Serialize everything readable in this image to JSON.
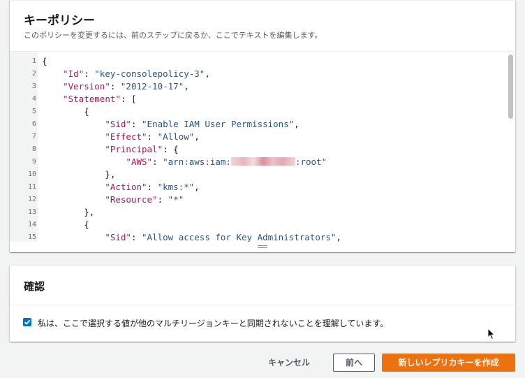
{
  "policy_panel": {
    "title": "キーポリシー",
    "description": "このポリシーを変更するには、前のステップに戻るか、ここでテキストを編集します。"
  },
  "editor": {
    "line_numbers": [
      "1",
      "2",
      "3",
      "4",
      "5",
      "6",
      "7",
      "8",
      "9",
      "10",
      "11",
      "12",
      "13",
      "14",
      "15"
    ],
    "lines": [
      [
        {
          "t": "p",
          "v": "{"
        }
      ],
      [
        {
          "t": "p",
          "v": "    "
        },
        {
          "t": "k",
          "v": "\"Id\""
        },
        {
          "t": "p",
          "v": ": "
        },
        {
          "t": "s",
          "v": "\"key-consolepolicy-3\""
        },
        {
          "t": "p",
          "v": ","
        }
      ],
      [
        {
          "t": "p",
          "v": "    "
        },
        {
          "t": "k",
          "v": "\"Version\""
        },
        {
          "t": "p",
          "v": ": "
        },
        {
          "t": "s",
          "v": "\"2012-10-17\""
        },
        {
          "t": "p",
          "v": ","
        }
      ],
      [
        {
          "t": "p",
          "v": "    "
        },
        {
          "t": "k",
          "v": "\"Statement\""
        },
        {
          "t": "p",
          "v": ": ["
        }
      ],
      [
        {
          "t": "p",
          "v": "        {"
        }
      ],
      [
        {
          "t": "p",
          "v": "            "
        },
        {
          "t": "k",
          "v": "\"Sid\""
        },
        {
          "t": "p",
          "v": ": "
        },
        {
          "t": "s",
          "v": "\"Enable IAM User Permissions\""
        },
        {
          "t": "p",
          "v": ","
        }
      ],
      [
        {
          "t": "p",
          "v": "            "
        },
        {
          "t": "k",
          "v": "\"Effect\""
        },
        {
          "t": "p",
          "v": ": "
        },
        {
          "t": "s",
          "v": "\"Allow\""
        },
        {
          "t": "p",
          "v": ","
        }
      ],
      [
        {
          "t": "p",
          "v": "            "
        },
        {
          "t": "k",
          "v": "\"Principal\""
        },
        {
          "t": "p",
          "v": ": {"
        }
      ],
      [
        {
          "t": "p",
          "v": "                "
        },
        {
          "t": "k",
          "v": "\"AWS\""
        },
        {
          "t": "p",
          "v": ": "
        },
        {
          "t": "s",
          "v": "\"arn:aws:iam:"
        },
        {
          "t": "r",
          "v": ""
        },
        {
          "t": "s",
          "v": ":root\""
        }
      ],
      [
        {
          "t": "p",
          "v": "            },"
        }
      ],
      [
        {
          "t": "p",
          "v": "            "
        },
        {
          "t": "k",
          "v": "\"Action\""
        },
        {
          "t": "p",
          "v": ": "
        },
        {
          "t": "s",
          "v": "\"kms:*\""
        },
        {
          "t": "p",
          "v": ","
        }
      ],
      [
        {
          "t": "p",
          "v": "            "
        },
        {
          "t": "k",
          "v": "\"Resource\""
        },
        {
          "t": "p",
          "v": ": "
        },
        {
          "t": "s",
          "v": "\"*\""
        }
      ],
      [
        {
          "t": "p",
          "v": "        },"
        }
      ],
      [
        {
          "t": "p",
          "v": "        {"
        }
      ],
      [
        {
          "t": "p",
          "v": "            "
        },
        {
          "t": "k",
          "v": "\"Sid\""
        },
        {
          "t": "p",
          "v": ": "
        },
        {
          "t": "s",
          "v": "\"Allow access for Key Administrators\""
        },
        {
          "t": "p",
          "v": ","
        }
      ]
    ]
  },
  "confirm_panel": {
    "title": "確認",
    "checkbox_checked": true,
    "checkbox_label": "私は、ここで選択する値が他のマルチリージョンキーと同期されないことを理解しています。"
  },
  "actions": {
    "cancel_label": "キャンセル",
    "prev_label": "前へ",
    "create_label": "新しいレプリカキーを作成"
  },
  "colors": {
    "primary_button": "#ec7211",
    "checkbox": "#0073bb",
    "json_key": "#b5135d",
    "json_string": "#1d5794"
  },
  "icons": {
    "checkbox": "check-icon",
    "resize": "resize-grip-icon",
    "cursor": "mouse-pointer-icon"
  }
}
